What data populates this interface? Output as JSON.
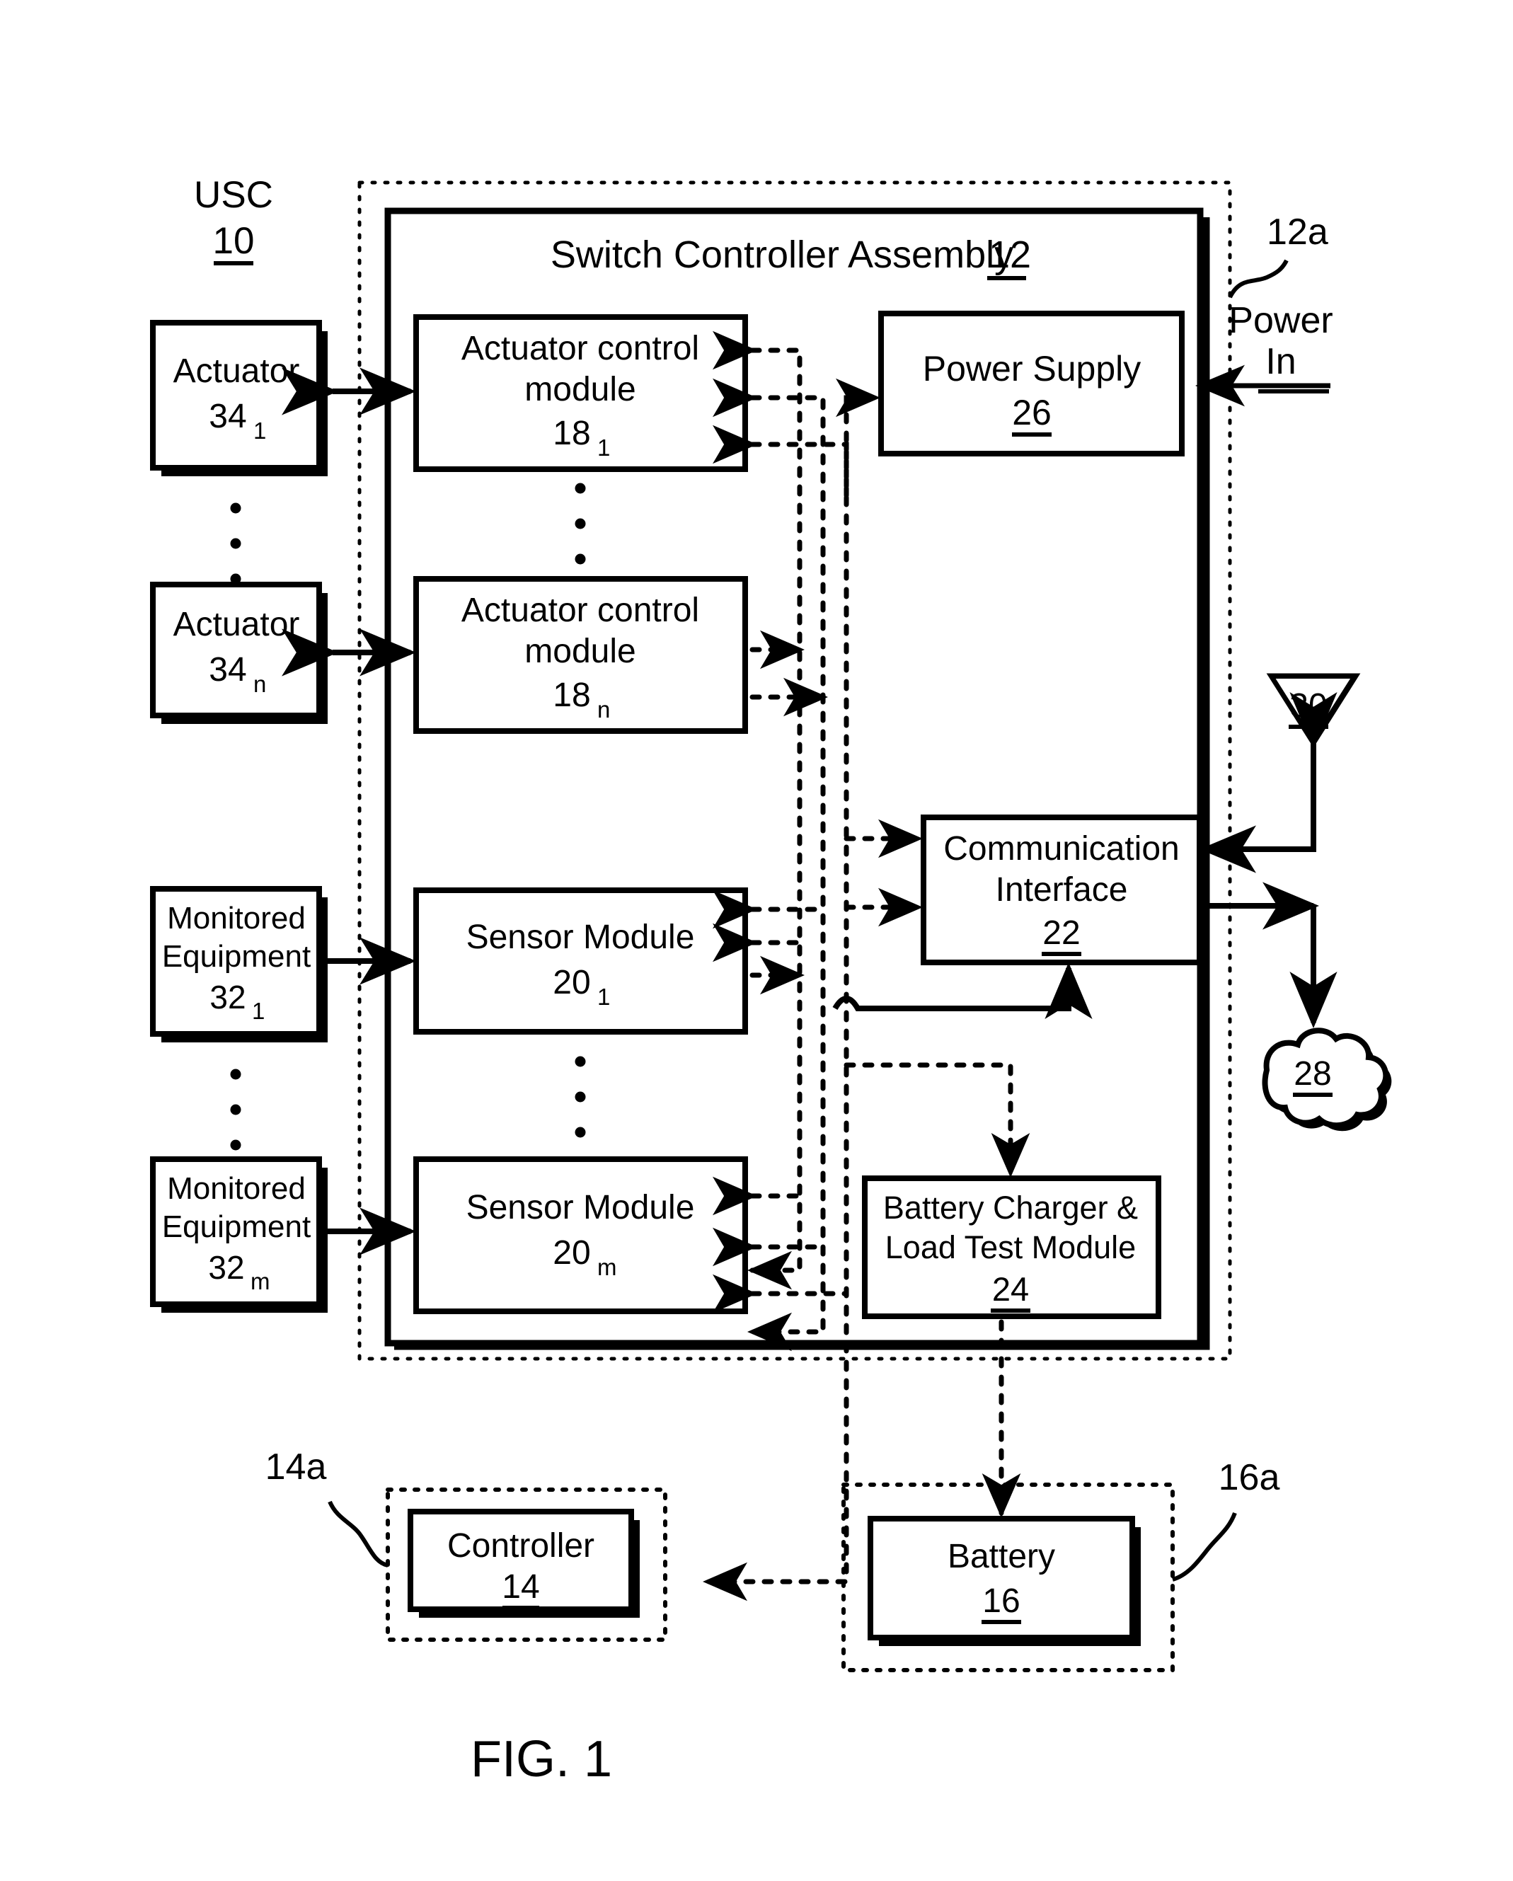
{
  "figure": {
    "caption": "FIG. 1",
    "system_label": "USC",
    "system_ref": "10"
  },
  "boundaries": {
    "assembly_dashed_ref": "12a",
    "controller_dashed_ref": "14a",
    "battery_dashed_ref": "16a"
  },
  "assembly": {
    "title": "Switch Controller Assembly",
    "ref": "12"
  },
  "external_left": {
    "actuators": [
      {
        "name": "Actuator",
        "ref": "34",
        "sub": "1"
      },
      {
        "name": "Actuator",
        "ref": "34",
        "sub": "n"
      }
    ],
    "monitored_equipment": [
      {
        "line1": "Monitored",
        "line2": "Equipment",
        "ref": "32",
        "sub": "1"
      },
      {
        "line1": "Monitored",
        "line2": "Equipment",
        "ref": "32",
        "sub": "m"
      }
    ]
  },
  "modules": {
    "actuator_control": [
      {
        "line1": "Actuator control",
        "line2": "module",
        "ref": "18",
        "sub": "1"
      },
      {
        "line1": "Actuator control",
        "line2": "module",
        "ref": "18",
        "sub": "n"
      }
    ],
    "sensor": [
      {
        "line1": "Sensor Module",
        "ref": "20",
        "sub": "1"
      },
      {
        "line1": "Sensor Module",
        "ref": "20",
        "sub": "m"
      }
    ],
    "power_supply": {
      "label": "Power Supply",
      "ref": "26"
    },
    "communication_interface": {
      "line1": "Communication",
      "line2": "Interface",
      "ref": "22"
    },
    "battery_charger": {
      "line1": "Battery Charger &",
      "line2": "Load Test Module",
      "ref": "24"
    }
  },
  "external_bottom": {
    "controller": {
      "label": "Controller",
      "ref": "14"
    },
    "battery": {
      "label": "Battery",
      "ref": "16"
    }
  },
  "network": {
    "antenna_ref": "30",
    "cloud_ref": "28"
  },
  "power_in": {
    "line1": "Power",
    "line2": "In"
  },
  "ellipses": {
    "glyph": "•"
  },
  "colors": {
    "stroke": "#000000",
    "fill": "#ffffff",
    "background": "#ffffff"
  }
}
